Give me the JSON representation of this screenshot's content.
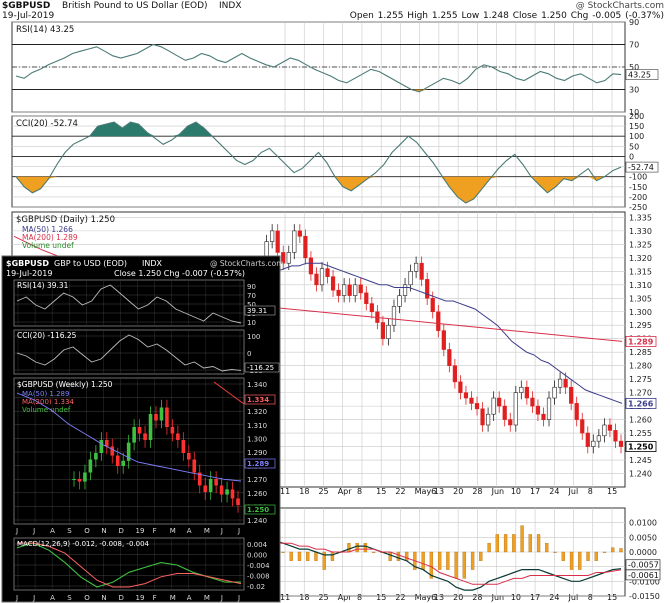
{
  "header": {
    "symbol": "$GBPUSD",
    "name": "British Pound to US Dollar (EOD)",
    "exchange": "INDX",
    "date": "19-Jul-2019",
    "watermark": "@ StockCharts.com",
    "ohlc_line": "Open 1.255  High 1.255  Low 1.248  Close 1.250  Chg -0.005 (-0.37%)"
  },
  "colors": {
    "grid": "#c8c8c8",
    "ma50": "#3c3c8c",
    "ma200": "#d8304a",
    "up_candle": "#ffffff",
    "down_candle": "#e02020",
    "oscillator_line": "#4a7a76",
    "fill_high": "#2c7a6c",
    "fill_low": "#f0a020",
    "inset_bg": "#000000"
  },
  "chart_data": [
    {
      "id": "rsi_daily",
      "type": "line",
      "label": "RSI(14) 43.25",
      "last_value": 43.25,
      "ylim": [
        10,
        90
      ],
      "ticks": [
        10,
        30,
        50,
        70,
        90
      ],
      "levels": [
        30,
        70
      ],
      "midline": 50,
      "values": [
        42,
        40,
        45,
        48,
        52,
        55,
        58,
        62,
        64,
        66,
        68,
        64,
        60,
        58,
        60,
        62,
        66,
        70,
        68,
        64,
        60,
        56,
        58,
        62,
        60,
        56,
        54,
        58,
        62,
        58,
        55,
        52,
        50,
        54,
        58,
        56,
        52,
        48,
        45,
        42,
        38,
        36,
        40,
        44,
        48,
        46,
        42,
        38,
        34,
        30,
        28,
        32,
        36,
        40,
        38,
        35,
        40,
        48,
        52,
        50,
        46,
        44,
        40,
        38,
        42,
        46,
        44,
        40,
        38,
        42,
        44,
        40,
        36,
        38,
        44,
        43.25
      ]
    },
    {
      "id": "cci_daily",
      "type": "line",
      "label": "CCI(20) -52.74",
      "last_value": -52.74,
      "ylim": [
        -250,
        200
      ],
      "ticks": [
        -250,
        -200,
        -150,
        -100,
        -50,
        0,
        50,
        100,
        150,
        200
      ],
      "levels": [
        -100,
        0,
        100
      ],
      "values": [
        -100,
        -150,
        -180,
        -160,
        -110,
        -40,
        20,
        60,
        80,
        100,
        150,
        160,
        170,
        140,
        170,
        160,
        120,
        90,
        60,
        80,
        110,
        150,
        170,
        140,
        100,
        60,
        20,
        -20,
        -40,
        -20,
        20,
        40,
        0,
        -40,
        -80,
        -60,
        -20,
        20,
        -30,
        -100,
        -150,
        -170,
        -140,
        -110,
        -80,
        -40,
        20,
        60,
        100,
        70,
        20,
        -30,
        -90,
        -150,
        -200,
        -230,
        -210,
        -160,
        -110,
        -60,
        -20,
        10,
        -40,
        -100,
        -140,
        -180,
        -150,
        -110,
        -120,
        -90,
        -60,
        -120,
        -100,
        -70,
        -52.74
      ]
    },
    {
      "id": "price_daily",
      "type": "candlestick",
      "label": "$GBPUSD (Daily) 1.250",
      "legend": [
        "MA(50) 1.266",
        "MA(200) 1.289",
        "Volume undef"
      ],
      "ylim": [
        1.235,
        1.337
      ],
      "ticks": [
        1.24,
        1.245,
        1.25,
        1.255,
        1.26,
        1.265,
        1.27,
        1.275,
        1.28,
        1.285,
        1.29,
        1.295,
        1.3,
        1.305,
        1.31,
        1.315,
        1.32,
        1.325,
        1.33,
        1.335
      ],
      "tick_labels": [
        "1.240",
        "1.245",
        "1.250",
        "1.255",
        "1.260",
        "1.265",
        "1.270",
        "1.275",
        "1.280",
        "1.285",
        "1.290",
        "1.295",
        "1.300",
        "1.305",
        "1.310",
        "1.315",
        "1.320",
        "1.325",
        "1.330",
        "1.335"
      ],
      "markers": [
        {
          "label": "1.289",
          "value": 1.289,
          "series": "MA(200)"
        },
        {
          "label": "1.266",
          "value": 1.266,
          "series": "MA(50)"
        },
        {
          "label": "1.250",
          "value": 1.25,
          "series": "close"
        }
      ],
      "closes": [
        1.305,
        1.31,
        1.318,
        1.326,
        1.33,
        1.322,
        1.318,
        1.322,
        1.33,
        1.328,
        1.32,
        1.314,
        1.31,
        1.316,
        1.313,
        1.308,
        1.306,
        1.31,
        1.306,
        1.31,
        1.307,
        1.303,
        1.3,
        1.296,
        1.29,
        1.295,
        1.302,
        1.306,
        1.31,
        1.315,
        1.318,
        1.312,
        1.305,
        1.3,
        1.293,
        1.286,
        1.28,
        1.274,
        1.27,
        1.268,
        1.266,
        1.264,
        1.258,
        1.262,
        1.268,
        1.265,
        1.26,
        1.258,
        1.27,
        1.272,
        1.268,
        1.265,
        1.262,
        1.26,
        1.268,
        1.272,
        1.275,
        1.272,
        1.266,
        1.26,
        1.255,
        1.25,
        1.252,
        1.254,
        1.258,
        1.256,
        1.252,
        1.25
      ],
      "ma50": [
        1.31,
        1.312,
        1.314,
        1.315,
        1.316,
        1.317,
        1.317,
        1.318,
        1.318,
        1.318,
        1.317,
        1.316,
        1.315,
        1.314,
        1.313,
        1.312,
        1.311,
        1.31,
        1.31,
        1.309,
        1.309,
        1.309,
        1.308,
        1.307,
        1.306,
        1.305,
        1.304,
        1.304,
        1.303,
        1.302,
        1.301,
        1.299,
        1.297,
        1.295,
        1.292,
        1.289,
        1.287,
        1.285,
        1.284,
        1.282,
        1.281,
        1.279,
        1.277,
        1.275,
        1.273,
        1.271,
        1.27,
        1.269,
        1.268,
        1.267,
        1.266
      ],
      "ma200": [
        1.328,
        1.323,
        1.319,
        1.315,
        1.312,
        1.309,
        1.307,
        1.305,
        1.303,
        1.302,
        1.301,
        1.3,
        1.299,
        1.298,
        1.297,
        1.296,
        1.295,
        1.294,
        1.293,
        1.292,
        1.291,
        1.29,
        1.289
      ],
      "x_labels": [
        "11",
        "18",
        "25",
        "Apr",
        "8",
        "15",
        "22",
        "May6",
        "13",
        "20",
        "28",
        "Jun",
        "10",
        "17",
        "24",
        "Jul",
        "8",
        "15"
      ]
    },
    {
      "id": "macd_daily",
      "type": "line",
      "label": "MACD",
      "ylim": [
        -0.015,
        0.015
      ],
      "ticks": [
        -0.015,
        -0.01,
        -0.005,
        0,
        0.005,
        0.01
      ],
      "tick_labels": [
        "-0.0150",
        "-0.0100",
        "-0.0050",
        "0.0000",
        "0.0050",
        "0.0100"
      ],
      "markers": [
        {
          "label": "-0.0057",
          "value": -0.0057
        },
        {
          "label": "-0.0061",
          "value": -0.0061
        }
      ],
      "macd": [
        0.002,
        0.003,
        0.004,
        0.004,
        0.003,
        0.002,
        0.001,
        0.001,
        0,
        -0.001,
        -0.001,
        0,
        0.001,
        0.002,
        0.002,
        0.001,
        0,
        -0.001,
        -0.002,
        -0.003,
        -0.005,
        -0.006,
        -0.008,
        -0.009,
        -0.01,
        -0.012,
        -0.013,
        -0.013,
        -0.012,
        -0.01,
        -0.009,
        -0.008,
        -0.007,
        -0.006,
        -0.006,
        -0.006,
        -0.007,
        -0.008,
        -0.009,
        -0.01,
        -0.01,
        -0.009,
        -0.008,
        -0.007,
        -0.006,
        -0.0057
      ],
      "signal": [
        0.003,
        0.003,
        0.003,
        0.003,
        0.003,
        0.003,
        0.002,
        0.002,
        0.001,
        0.001,
        0,
        0,
        0,
        0.001,
        0.001,
        0.001,
        0,
        0,
        -0.001,
        -0.002,
        -0.003,
        -0.004,
        -0.005,
        -0.007,
        -0.008,
        -0.009,
        -0.01,
        -0.011,
        -0.011,
        -0.011,
        -0.011,
        -0.01,
        -0.009,
        -0.009,
        -0.008,
        -0.008,
        -0.008,
        -0.008,
        -0.008,
        -0.008,
        -0.008,
        -0.008,
        -0.007,
        -0.007,
        -0.0065,
        -0.0061
      ]
    }
  ],
  "inset": {
    "header_symbol": "$GBPUSD",
    "header_name": "GBP to USD (EOD)",
    "header_exchange": "INDX",
    "header_date": "19-Jul-2019",
    "header_ohlc": "Close 1.250  Chg -0.007 (-0.57%)",
    "watermark": "@ StockCharts.com",
    "rsi_label": "RSI(14) 39.31",
    "rsi_ticks": [
      "90",
      "70",
      "50",
      "30",
      "10"
    ],
    "rsi_marker": "39.31",
    "cci_label": "CCI(20) -116.25",
    "cci_ticks": [
      "100",
      "0",
      "-100"
    ],
    "cci_marker": "-116.25",
    "price_label": "$GBPUSD (Weekly) 1.250",
    "price_legend": [
      "MA(50) 1.289",
      "MA(200) 1.334",
      "Volume undef"
    ],
    "price_ticks": [
      "1.340",
      "1.330",
      "1.320",
      "1.310",
      "1.300",
      "1.290",
      "1.280",
      "1.270",
      "1.260",
      "1.250",
      "1.240"
    ],
    "price_markers": [
      "1.334",
      "1.289",
      "1.250"
    ],
    "macd_label": "MACD(12,26,9) -0.012, -0.008, -0.004",
    "macd_ticks": [
      "0.004",
      "0.000",
      "-0.004",
      "-0.008",
      "-0.02"
    ],
    "x_labels": [
      "J",
      "J",
      "A",
      "S",
      "O",
      "N",
      "D",
      "19",
      "F",
      "M",
      "A",
      "M",
      "J",
      "J"
    ]
  }
}
